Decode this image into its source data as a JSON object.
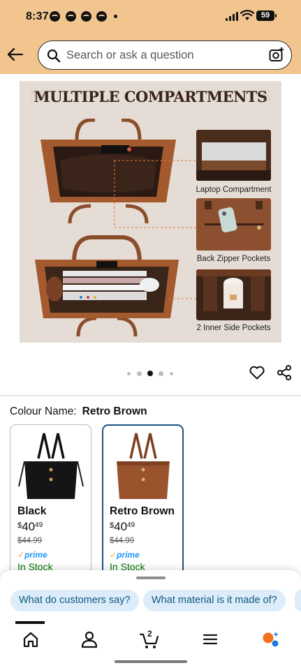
{
  "status_bar": {
    "time": "8:37",
    "battery": "59"
  },
  "header": {
    "search_placeholder": "Search or ask a question",
    "back_icon": "arrow-left-icon",
    "camera_icon": "camera-search-icon"
  },
  "product_image": {
    "title": "MULTIPLE COMPARTMENTS",
    "ghost_left": "M",
    "ghost_right": "S",
    "captions": [
      "Laptop Compartment",
      "Back Zipper Pockets",
      "2 Inner Side Pockets"
    ]
  },
  "carousel": {
    "count": 5,
    "active_index": 2
  },
  "colour": {
    "label": "Colour Name:",
    "selected": "Retro Brown",
    "options": [
      {
        "name": "Black",
        "currency": "$",
        "price_whole": "40",
        "price_cents": "49",
        "list_price": "$44.99",
        "prime": "prime",
        "stock": "In Stock",
        "selected": false
      },
      {
        "name": "Retro Brown",
        "currency": "$",
        "price_whole": "40",
        "price_cents": "49",
        "list_price": "$44.99",
        "prime": "prime",
        "stock": "In Stock",
        "selected": true
      }
    ]
  },
  "suggestions": [
    "What do customers say?",
    "What material is it made of?"
  ],
  "bottom_nav": {
    "items": [
      "home-icon",
      "account-icon",
      "cart-icon",
      "menu-icon",
      "rufus-icon"
    ],
    "cart_count": "2"
  },
  "colors": {
    "header_bg": "#f2c58f",
    "selected_border": "#1a5286",
    "chip_bg": "#dcecf8",
    "chip_text": "#0f5a85",
    "stock_green": "#007600",
    "prime_blue": "#1a98ff"
  }
}
